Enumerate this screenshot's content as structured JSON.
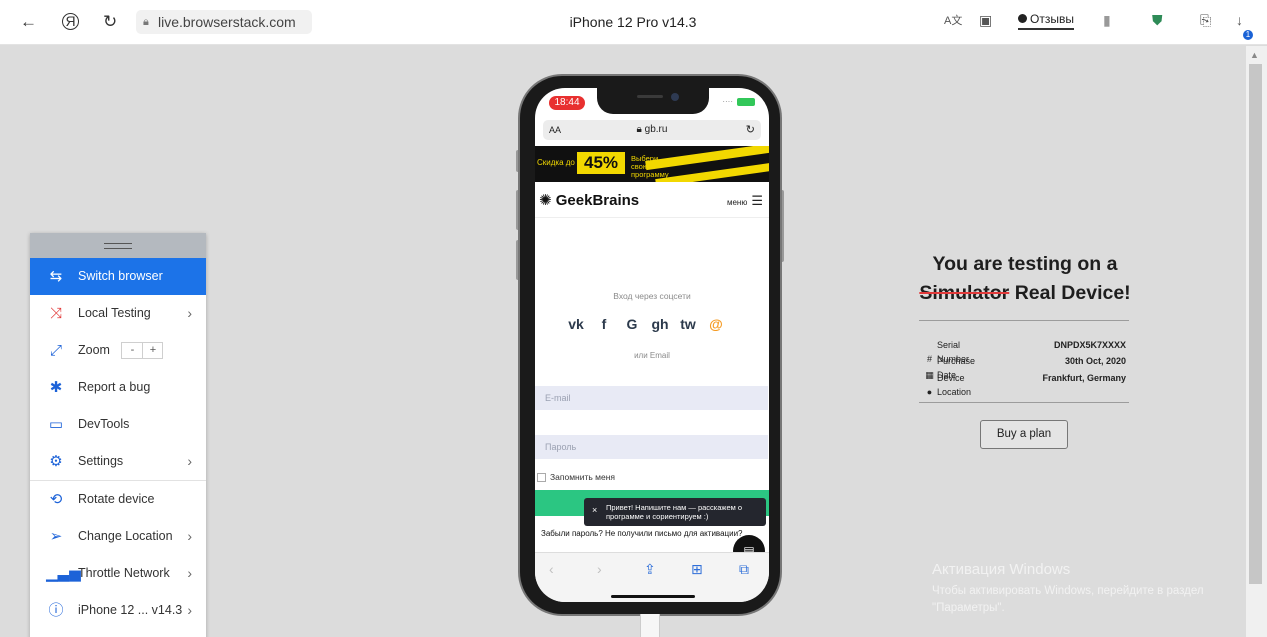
{
  "browser": {
    "address": "live.browserstack.com",
    "page_title": "iPhone 12 Pro v14.3",
    "reviews_label": "Отзывы",
    "download_badge": "1"
  },
  "toolbar": {
    "items": [
      {
        "label": "Switch browser",
        "icon": "switch-browser-icon"
      },
      {
        "label": "Local Testing",
        "icon": "local-testing-icon"
      },
      {
        "label": "Zoom",
        "icon": "zoom-icon",
        "zoom_minus": "-",
        "zoom_plus": "+"
      },
      {
        "label": "Report a bug",
        "icon": "bug-icon"
      },
      {
        "label": "DevTools",
        "icon": "devtools-icon"
      },
      {
        "label": "Settings",
        "icon": "gear-icon"
      },
      {
        "label": "Rotate device",
        "icon": "rotate-device-icon"
      },
      {
        "label": "Change Location",
        "icon": "location-arrow-icon"
      },
      {
        "label": "Throttle Network",
        "icon": "network-bars-icon"
      },
      {
        "label": "iPhone 12 ... v14.3",
        "icon": "info-icon"
      }
    ]
  },
  "device": {
    "time": "18:44",
    "url_aa": "AA",
    "url_domain": "gb.ru",
    "banner_text": "Скидка до",
    "banner_percent": "45%",
    "banner_cta": "Выбери свою программу",
    "brand": "GeekBrains",
    "menu_label": "меню",
    "social_title": "Вход через соцсети",
    "socials": [
      "vk",
      "f",
      "G",
      "gh",
      "tw",
      "@"
    ],
    "or_email": "или Email",
    "email_placeholder": "E-mail",
    "password_placeholder": "Пароль",
    "remember": "Запомнить меня",
    "chat_tooltip": "Привет! Напишите нам — расскажем о программе и сориентируем :)",
    "forgot": "Забыли пароль?  Не получили письмо для активации?"
  },
  "info": {
    "title_line1": "You are testing on a",
    "title_struck": "Simulator",
    "title_rest": "Real Device!",
    "rows": [
      {
        "key": "Serial Number",
        "value": "DNPDX5K7XXXX"
      },
      {
        "key": "Purchase Date",
        "value": "30th Oct, 2020"
      },
      {
        "key": "Device Location",
        "value": "Frankfurt, Germany"
      }
    ],
    "buy_label": "Buy a plan"
  },
  "watermark": {
    "line1": "Активация Windows",
    "line2": "Чтобы активировать Windows, перейдите в раздел \"Параметры\"."
  }
}
